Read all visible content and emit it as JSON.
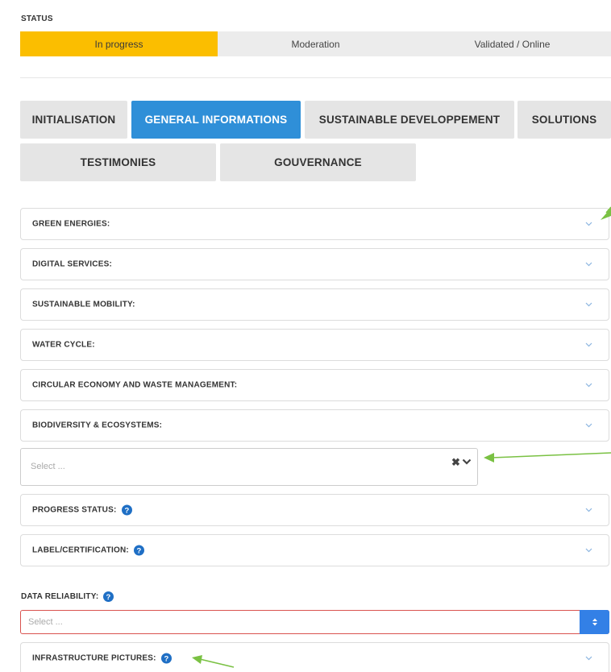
{
  "status": {
    "title": "STATUS",
    "segments": [
      "In progress",
      "Moderation",
      "Validated / Online"
    ],
    "active_color": "#fbbe00"
  },
  "tabs": [
    {
      "label": "INITIALISATION"
    },
    {
      "label": "GENERAL INFORMATIONS",
      "active": true
    },
    {
      "label": "SUSTAINABLE DEVELOPPEMENT"
    },
    {
      "label": "SOLUTIONS"
    },
    {
      "label": "TESTIMONIES"
    },
    {
      "label": "GOUVERNANCE"
    }
  ],
  "accordions": [
    {
      "label": "GREEN ENERGIES:"
    },
    {
      "label": "DIGITAL SERVICES:"
    },
    {
      "label": "SUSTAINABLE MOBILITY:"
    },
    {
      "label": "WATER CYCLE:"
    },
    {
      "label": "CIRCULAR ECONOMY AND WASTE MANAGEMENT:"
    },
    {
      "label": "BIODIVERSITY & ECOSYSTEMS:"
    },
    {
      "label": "PROGRESS STATUS:"
    },
    {
      "label": "LABEL/CERTIFICATION:"
    },
    {
      "label": "INFRASTRUCTURE PICTURES:"
    }
  ],
  "multiselect": {
    "placeholder": "Select ...",
    "clear_glyph": "✖"
  },
  "data_reliability": {
    "label": "DATA RELIABILITY:",
    "placeholder": "Select ...",
    "button_glyph": "⬍"
  },
  "colors": {
    "accent_blue": "#2f8fd8",
    "help_icon": "#1f6fc5",
    "error_border": "#d9534f",
    "annotation_arrow": "#7ac143"
  },
  "icons": [
    "chevron-down-icon",
    "help-circle-icon",
    "clear-x-icon",
    "up-down-icon"
  ]
}
